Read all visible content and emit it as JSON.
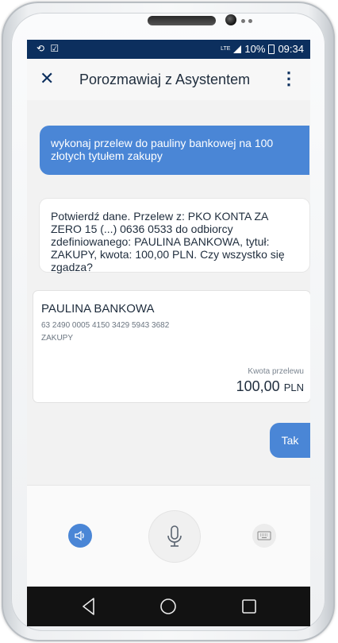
{
  "status_bar": {
    "left_icons": "⟲ ☑",
    "lte": "LTE",
    "battery": "10%",
    "time": "09:34"
  },
  "app_bar": {
    "title": "Porozmawiaj z Asystentem",
    "close_icon": "close-icon",
    "menu_icon": "kebab-icon"
  },
  "chat": {
    "user_message_1": "wykonaj przelew do pauliny bankowej na 100 złotych tytułem zakupy",
    "assistant_message": "Potwierdź dane. Przelew z: PKO KONTA ZA ZERO 15 (...) 0636 0533 do odbiorcy zdefiniowanego: PAULINA BANKOWA, tytuł: ZAKUPY, kwota: 100,00 PLN. Czy wszystko się zgadza?",
    "transfer_card": {
      "recipient": "PAULINA BANKOWA",
      "account": "63 2490 0005 4150 3429 5943 3682",
      "title": "ZAKUPY",
      "amount_label": "Kwota przelewu",
      "amount": "100,00",
      "currency": "PLN"
    },
    "user_message_2": "Tak"
  },
  "controls": {
    "speaker_icon": "speaker-icon",
    "mic_icon": "microphone-icon",
    "keyboard_icon": "keyboard-icon"
  },
  "colors": {
    "accent": "#4a86d6",
    "status_bar": "#0c2f5e",
    "nav_bar": "#121212",
    "background": "#f2f2f2"
  }
}
